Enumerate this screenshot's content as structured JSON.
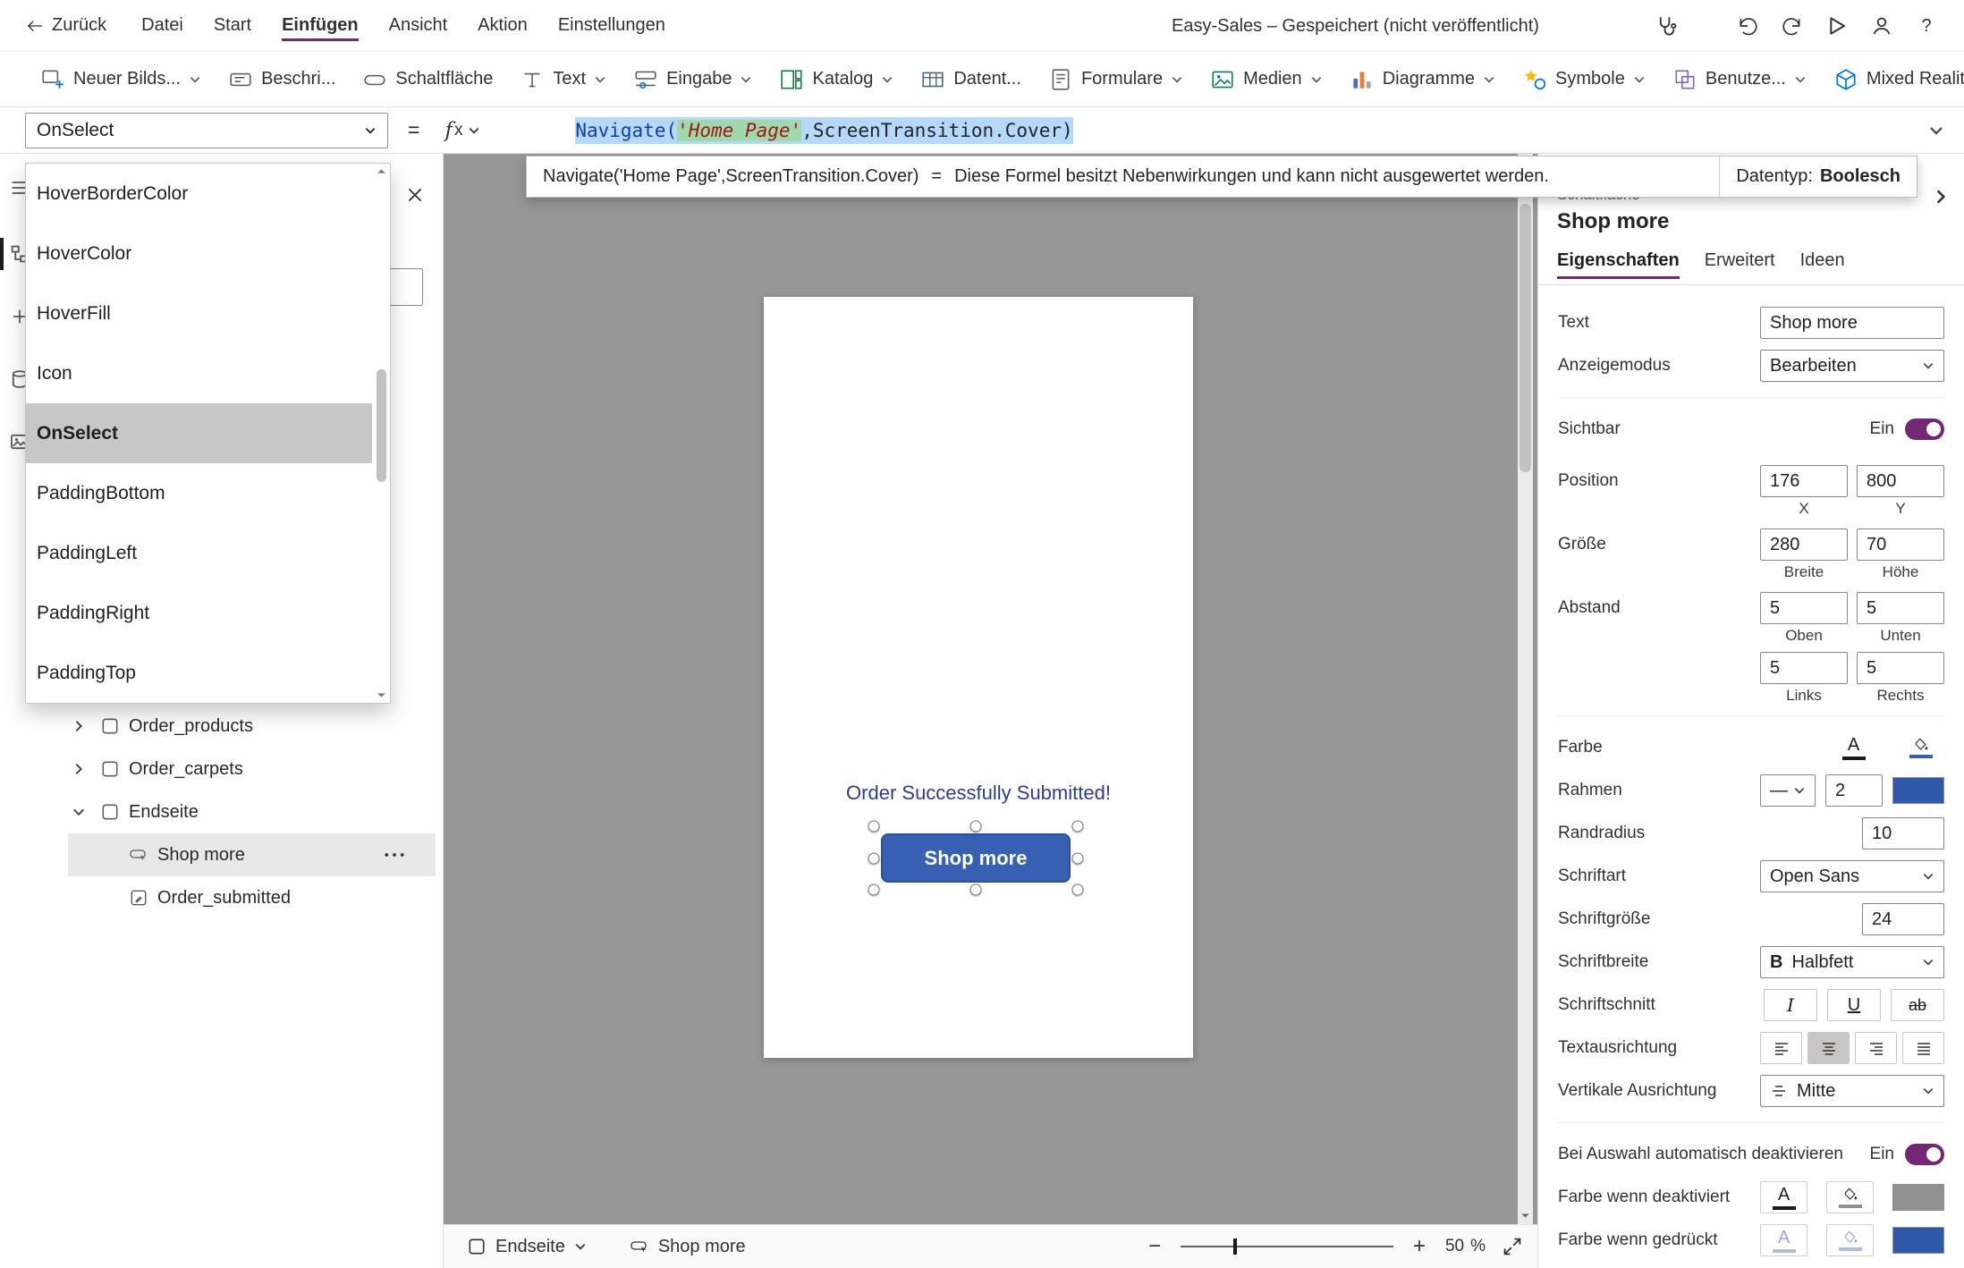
{
  "titlebar": {
    "back": "Zurück",
    "menus": [
      "Datei",
      "Start",
      "Einfügen",
      "Ansicht",
      "Aktion",
      "Einstellungen"
    ],
    "status": "Easy-Sales – Gespeichert (nicht veröffentlicht)",
    "help": "?"
  },
  "ribbon": [
    {
      "label": "Neuer Bilds..."
    },
    {
      "label": "Beschri..."
    },
    {
      "label": "Schaltfläche"
    },
    {
      "label": "Text"
    },
    {
      "label": "Eingabe"
    },
    {
      "label": "Katalog"
    },
    {
      "label": "Datent..."
    },
    {
      "label": "Formulare"
    },
    {
      "label": "Medien"
    },
    {
      "label": "Diagramme"
    },
    {
      "label": "Symbole"
    },
    {
      "label": "Benutze..."
    },
    {
      "label": "Mixed Reality"
    }
  ],
  "formula_bar": {
    "property": "OnSelect",
    "equals": "=",
    "fx": "f",
    "fx_x": "x",
    "code_func": "Navigate(",
    "code_string": "'Home Page'",
    "code_rest": ",ScreenTransition.Cover)"
  },
  "formula_info": {
    "expression": "Navigate('Home Page',ScreenTransition.Cover)",
    "equals": "=",
    "message": "Diese Formel besitzt Nebenwirkungen und kann nicht ausgewertet werden.",
    "datatype_label": "Datentyp:",
    "datatype_value": "Boolesch"
  },
  "property_list": {
    "items": [
      "HoverBorderColor",
      "HoverColor",
      "HoverFill",
      "Icon",
      "OnSelect",
      "PaddingBottom",
      "PaddingLeft",
      "PaddingRight",
      "PaddingTop"
    ],
    "selected": "OnSelect"
  },
  "tree": {
    "items": [
      {
        "label": "Order_products"
      },
      {
        "label": "Order_carpets"
      },
      {
        "label": "Endseite"
      },
      {
        "label": "Shop more"
      },
      {
        "label": "Order_submitted"
      }
    ]
  },
  "canvas": {
    "message": "Order Successfully Submitted!",
    "button": "Shop more",
    "button_fill": "#3860b2",
    "button_border": "#2b4f9e",
    "message_color": "#2e3d8a"
  },
  "statusbar": {
    "screen": "Endseite",
    "control": "Shop more",
    "minus": "−",
    "plus": "+",
    "zoom": "50",
    "percent": "%"
  },
  "panel": {
    "type": "Schaltfläche",
    "title": "Shop more",
    "tabs": [
      "Eigenschaften",
      "Erweitert",
      "Ideen"
    ],
    "active_tab": "Eigenschaften",
    "accent": "#742774",
    "rows": {
      "text": {
        "label": "Text",
        "value": "Shop more"
      },
      "mode": {
        "label": "Anzeigemodus",
        "value": "Bearbeiten"
      },
      "visible": {
        "label": "Sichtbar",
        "on": "Ein"
      },
      "position": {
        "label": "Position",
        "x": "176",
        "y": "800",
        "xl": "X",
        "yl": "Y"
      },
      "size": {
        "label": "Größe",
        "w": "280",
        "h": "70",
        "wl": "Breite",
        "hl": "Höhe"
      },
      "padding": {
        "label": "Abstand",
        "top": "5",
        "bottom": "5",
        "left": "5",
        "right": "5",
        "tl": "Oben",
        "bl": "Unten",
        "ll": "Links",
        "rl": "Rechts"
      },
      "color": {
        "label": "Farbe",
        "a": "A",
        "text_bar": "#1b1a19",
        "fill_bar": "#3860b2"
      },
      "border": {
        "label": "Rahmen",
        "style": "—",
        "width": "2",
        "color": "#2e59a8"
      },
      "radius": {
        "label": "Randradius",
        "value": "10"
      },
      "font": {
        "label": "Schriftart",
        "value": "Open Sans"
      },
      "fontsize": {
        "label": "Schriftgröße",
        "value": "24"
      },
      "fontweight": {
        "label": "Schriftbreite",
        "b": "B",
        "value": "Halbfett"
      },
      "fontstyle": {
        "label": "Schriftschnitt",
        "i": "I",
        "u": "U",
        "s": "ab"
      },
      "align": {
        "label": "Textausrichtung",
        "selected": "center"
      },
      "valign": {
        "label": "Vertikale Ausrichtung",
        "value": "Mitte"
      },
      "autodisable": {
        "label": "Bei Auswahl automatisch deaktivieren",
        "on": "Ein"
      },
      "disabledcolor": {
        "label": "Farbe wenn deaktiviert",
        "a": "A",
        "swatch": "#919191"
      },
      "pressedcolor": {
        "label": "Farbe wenn gedrückt",
        "a": "A",
        "swatch": "#2e59a8"
      }
    }
  }
}
